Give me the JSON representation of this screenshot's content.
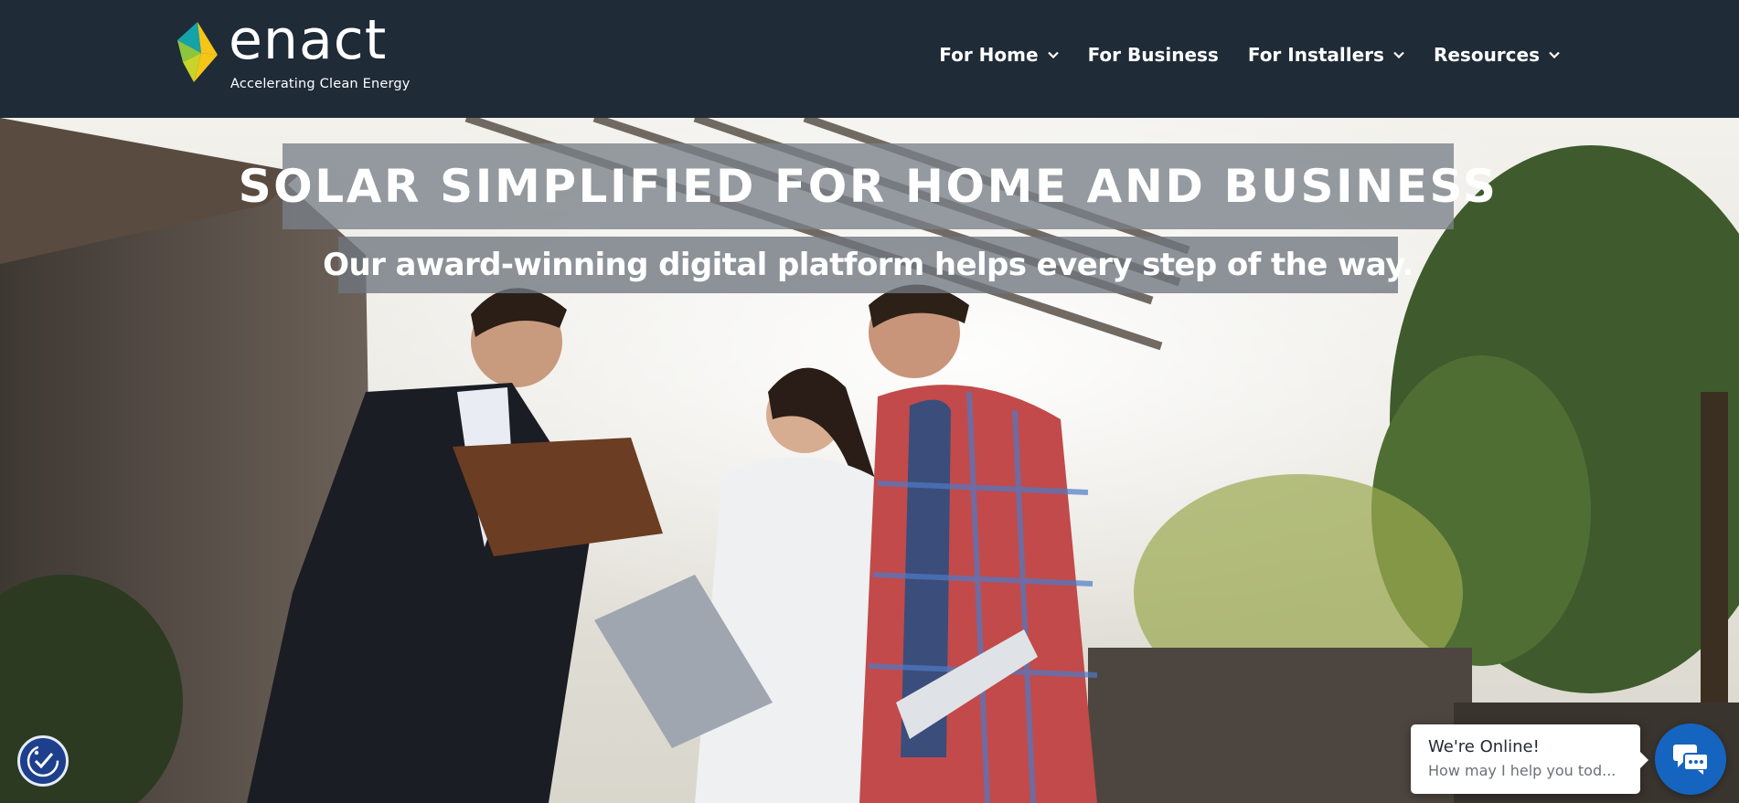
{
  "header": {
    "logo": {
      "wordmark": "enact",
      "tagline": "Accelerating Clean Energy"
    },
    "nav": [
      {
        "label": "For Home",
        "has_dropdown": true
      },
      {
        "label": "For Business",
        "has_dropdown": false
      },
      {
        "label": "For Installers",
        "has_dropdown": true
      },
      {
        "label": "Resources",
        "has_dropdown": true
      }
    ]
  },
  "hero": {
    "headline": "SOLAR SIMPLIFIED FOR HOME AND BUSINESS",
    "subheadline": "Our award-winning digital platform helps every step of the way."
  },
  "chat": {
    "title": "We're Online!",
    "subtitle": "How may I help you tod...",
    "icon": "chat-bubbles-icon"
  },
  "accessibility": {
    "icon": "accessibility-icon"
  },
  "colors": {
    "header_bg": "#1f2b37",
    "logo_green": "#8cc63f",
    "logo_teal": "#14a3a8",
    "logo_yellow": "#f5c518",
    "chat_blue": "#1565c0",
    "a11y_blue": "#1d3f8c"
  }
}
